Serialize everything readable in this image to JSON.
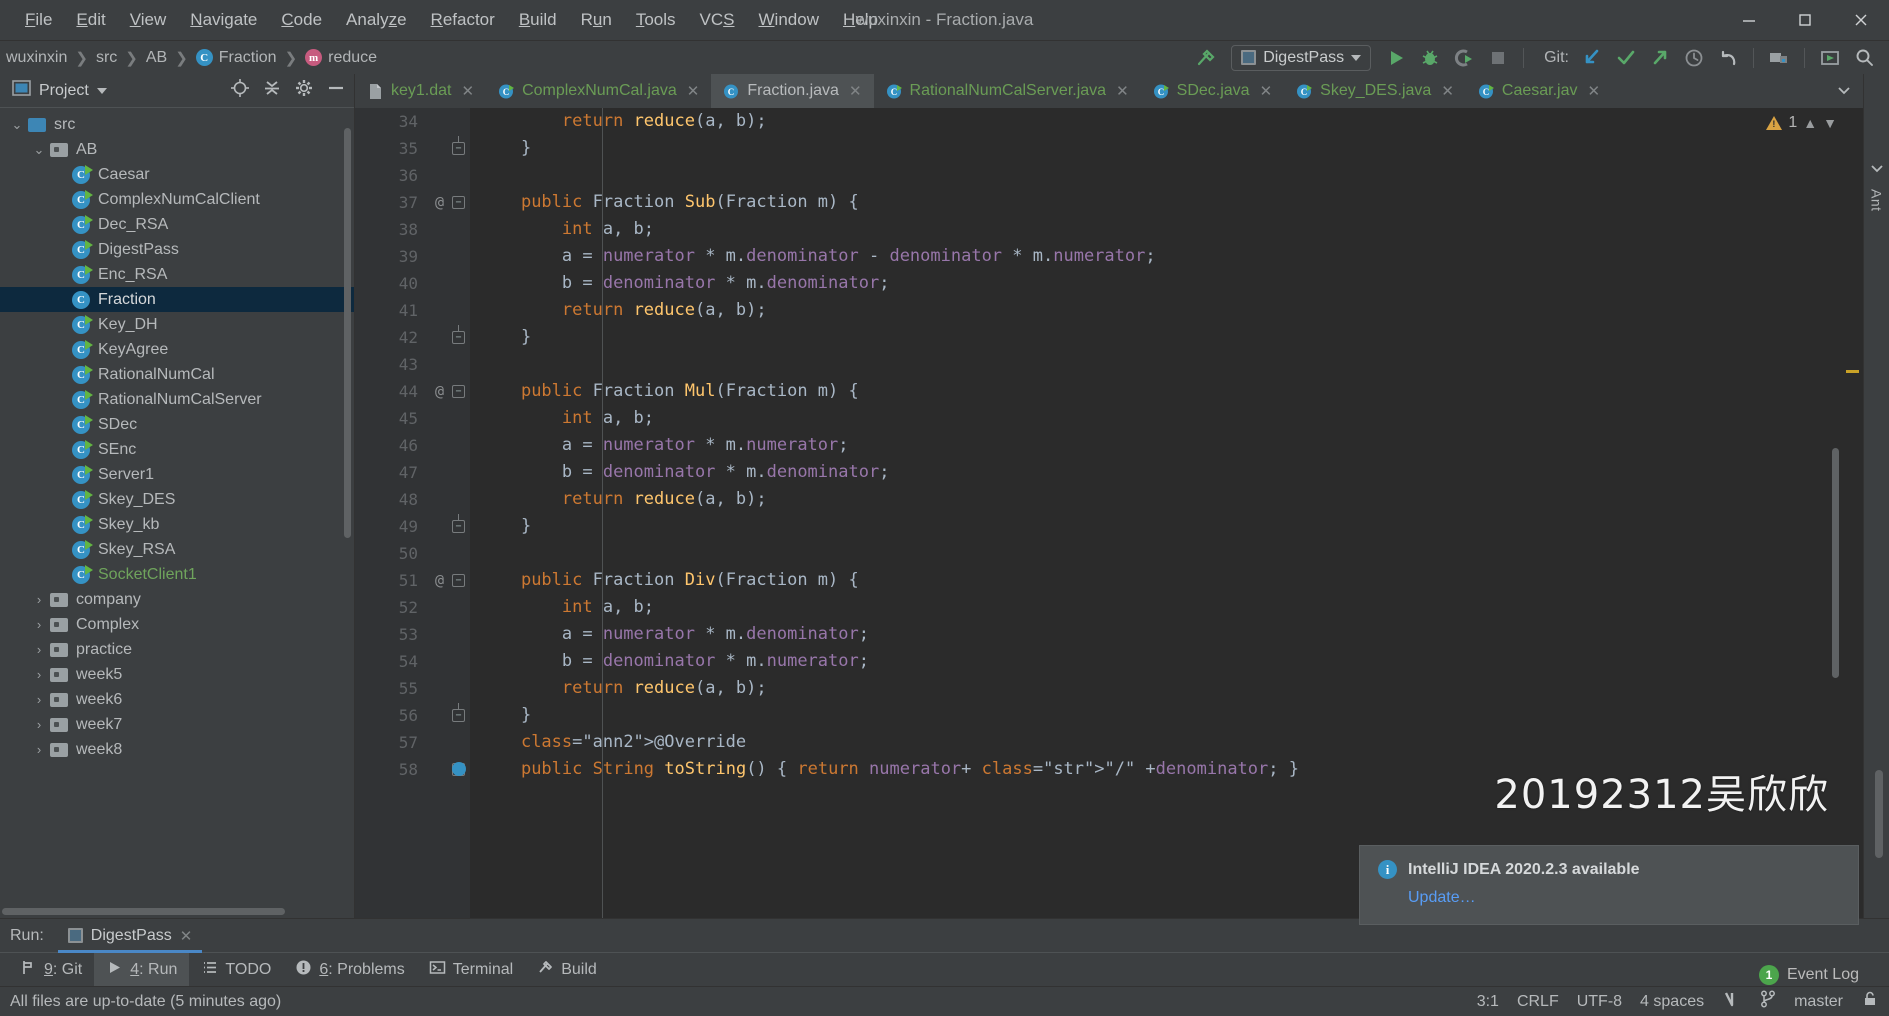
{
  "window": {
    "title": "wuxinxin - Fraction.java",
    "minimize": "minimize-icon",
    "maximize": "maximize-icon",
    "close": "close-icon"
  },
  "menu": [
    {
      "label": "File",
      "mnemonic": "F"
    },
    {
      "label": "Edit",
      "mnemonic": "E"
    },
    {
      "label": "View",
      "mnemonic": "V"
    },
    {
      "label": "Navigate",
      "mnemonic": "N"
    },
    {
      "label": "Code",
      "mnemonic": "C"
    },
    {
      "label": "Analyze",
      "mnemonic": "z"
    },
    {
      "label": "Refactor",
      "mnemonic": "R"
    },
    {
      "label": "Build",
      "mnemonic": "B"
    },
    {
      "label": "Run",
      "mnemonic": "u"
    },
    {
      "label": "Tools",
      "mnemonic": "T"
    },
    {
      "label": "VCS",
      "mnemonic": "S"
    },
    {
      "label": "Window",
      "mnemonic": "W"
    },
    {
      "label": "Help",
      "mnemonic": "H"
    }
  ],
  "breadcrumbs": [
    {
      "label": "wuxinxin",
      "icon": "none"
    },
    {
      "label": "src",
      "icon": "none"
    },
    {
      "label": "AB",
      "icon": "none"
    },
    {
      "label": "Fraction",
      "icon": "class"
    },
    {
      "label": "reduce",
      "icon": "method"
    }
  ],
  "toolbar": {
    "build_icon": "hammer-icon",
    "run_config": "DigestPass",
    "run_button": "run-icon",
    "debug_button": "debug-icon",
    "coverage_button": "run-with-coverage-icon",
    "stop_button": "stop-icon",
    "git_label": "Git:",
    "git_update": "update-project-icon",
    "git_commit": "commit-icon",
    "git_push": "push-icon",
    "git_history": "history-icon",
    "git_rollback": "rollback-icon",
    "project_structure": "project-structure-icon",
    "select_in": "select-in-icon",
    "search": "search-everywhere-icon"
  },
  "project_panel": {
    "title": "Project",
    "locate_icon": "locate-icon",
    "collapse_icon": "collapse-all-icon",
    "settings_icon": "gear-icon",
    "hide_icon": "hide-icon",
    "tree": [
      {
        "label": "src",
        "depth": 1,
        "type": "folder-src",
        "expanded": true,
        "selected": false
      },
      {
        "label": "AB",
        "depth": 2,
        "type": "folder",
        "expanded": true,
        "selected": false
      },
      {
        "label": "Caesar",
        "depth": 3,
        "type": "class-run",
        "selected": false
      },
      {
        "label": "ComplexNumCalClient",
        "depth": 3,
        "type": "class-run",
        "selected": false
      },
      {
        "label": "Dec_RSA",
        "depth": 3,
        "type": "class-run",
        "selected": false
      },
      {
        "label": "DigestPass",
        "depth": 3,
        "type": "class-run",
        "selected": false
      },
      {
        "label": "Enc_RSA",
        "depth": 3,
        "type": "class-run",
        "selected": false
      },
      {
        "label": "Fraction",
        "depth": 3,
        "type": "class",
        "selected": true
      },
      {
        "label": "Key_DH",
        "depth": 3,
        "type": "class-run",
        "selected": false
      },
      {
        "label": "KeyAgree",
        "depth": 3,
        "type": "class-run",
        "selected": false
      },
      {
        "label": "RationalNumCal",
        "depth": 3,
        "type": "class-run",
        "selected": false
      },
      {
        "label": "RationalNumCalServer",
        "depth": 3,
        "type": "class-run",
        "selected": false
      },
      {
        "label": "SDec",
        "depth": 3,
        "type": "class-run",
        "selected": false
      },
      {
        "label": "SEnc",
        "depth": 3,
        "type": "class-run",
        "selected": false
      },
      {
        "label": "Server1",
        "depth": 3,
        "type": "class-run",
        "selected": false
      },
      {
        "label": "Skey_DES",
        "depth": 3,
        "type": "class-run",
        "selected": false
      },
      {
        "label": "Skey_kb",
        "depth": 3,
        "type": "class-run",
        "selected": false
      },
      {
        "label": "Skey_RSA",
        "depth": 3,
        "type": "class-run",
        "selected": false
      },
      {
        "label": "SocketClient1",
        "depth": 3,
        "type": "class-run",
        "selected": false,
        "color": "green"
      },
      {
        "label": "company",
        "depth": 2,
        "type": "folder",
        "expanded": false,
        "selected": false
      },
      {
        "label": "Complex",
        "depth": 2,
        "type": "folder",
        "expanded": false,
        "selected": false
      },
      {
        "label": "practice",
        "depth": 2,
        "type": "folder",
        "expanded": false,
        "selected": false
      },
      {
        "label": "week5",
        "depth": 2,
        "type": "folder",
        "expanded": false,
        "selected": false
      },
      {
        "label": "week6",
        "depth": 2,
        "type": "folder",
        "expanded": false,
        "selected": false
      },
      {
        "label": "week7",
        "depth": 2,
        "type": "folder",
        "expanded": false,
        "selected": false
      },
      {
        "label": "week8",
        "depth": 2,
        "type": "folder",
        "expanded": false,
        "selected": false
      }
    ]
  },
  "editor_tabs": [
    {
      "label": "key1.dat",
      "icon": "file-icon",
      "active": false,
      "color": "green"
    },
    {
      "label": "ComplexNumCal.java",
      "icon": "class-run",
      "active": false,
      "color": "green"
    },
    {
      "label": "Fraction.java",
      "icon": "class",
      "active": true,
      "color": "normal"
    },
    {
      "label": "RationalNumCalServer.java",
      "icon": "class-run",
      "active": false,
      "color": "green"
    },
    {
      "label": "SDec.java",
      "icon": "class-run",
      "active": false,
      "color": "green"
    },
    {
      "label": "Skey_DES.java",
      "icon": "class-run",
      "active": false,
      "color": "green"
    },
    {
      "label": "Caesar.jav",
      "icon": "class-run",
      "active": false,
      "color": "green"
    }
  ],
  "editor": {
    "warning_count": "1",
    "first_line": 34,
    "lines": [
      {
        "n": 34,
        "ann": "",
        "fold": "",
        "text": "        return reduce(a, b);"
      },
      {
        "n": 35,
        "ann": "",
        "fold": "end",
        "text": "    }"
      },
      {
        "n": 36,
        "ann": "",
        "fold": "",
        "text": ""
      },
      {
        "n": 37,
        "ann": "@",
        "fold": "start",
        "text": "    public Fraction Sub(Fraction m) {"
      },
      {
        "n": 38,
        "ann": "",
        "fold": "",
        "text": "        int a, b;"
      },
      {
        "n": 39,
        "ann": "",
        "fold": "",
        "text": "        a = numerator * m.denominator - denominator * m.numerator;"
      },
      {
        "n": 40,
        "ann": "",
        "fold": "",
        "text": "        b = denominator * m.denominator;"
      },
      {
        "n": 41,
        "ann": "",
        "fold": "",
        "text": "        return reduce(a, b);"
      },
      {
        "n": 42,
        "ann": "",
        "fold": "end",
        "text": "    }"
      },
      {
        "n": 43,
        "ann": "",
        "fold": "",
        "text": ""
      },
      {
        "n": 44,
        "ann": "@",
        "fold": "start",
        "text": "    public Fraction Mul(Fraction m) {"
      },
      {
        "n": 45,
        "ann": "",
        "fold": "",
        "text": "        int a, b;"
      },
      {
        "n": 46,
        "ann": "",
        "fold": "",
        "text": "        a = numerator * m.numerator;"
      },
      {
        "n": 47,
        "ann": "",
        "fold": "",
        "text": "        b = denominator * m.denominator;"
      },
      {
        "n": 48,
        "ann": "",
        "fold": "",
        "text": "        return reduce(a, b);"
      },
      {
        "n": 49,
        "ann": "",
        "fold": "end",
        "text": "    }"
      },
      {
        "n": 50,
        "ann": "",
        "fold": "",
        "text": ""
      },
      {
        "n": 51,
        "ann": "@",
        "fold": "start",
        "text": "    public Fraction Div(Fraction m) {"
      },
      {
        "n": 52,
        "ann": "",
        "fold": "",
        "text": "        int a, b;"
      },
      {
        "n": 53,
        "ann": "",
        "fold": "",
        "text": "        a = numerator * m.denominator;"
      },
      {
        "n": 54,
        "ann": "",
        "fold": "",
        "text": "        b = denominator * m.numerator;"
      },
      {
        "n": 55,
        "ann": "",
        "fold": "",
        "text": "        return reduce(a, b);"
      },
      {
        "n": 56,
        "ann": "",
        "fold": "end",
        "text": "    }"
      },
      {
        "n": 57,
        "ann": "",
        "fold": "",
        "text": "    @Override"
      },
      {
        "n": 58,
        "ann": "",
        "fold": "start",
        "text": "    public String toString() { return numerator+ \"/\" +denominator; }"
      }
    ]
  },
  "right_strip": {
    "ant_label": "Ant"
  },
  "run_window": {
    "label": "Run:",
    "tab": "DigestPass",
    "close": "close-icon"
  },
  "tool_buttons": [
    {
      "label": "9: Git",
      "mnemonic": "9",
      "icon": "git-icon",
      "active": false
    },
    {
      "label": "4: Run",
      "mnemonic": "4",
      "icon": "run-icon",
      "active": true
    },
    {
      "label": "TODO",
      "mnemonic": "",
      "icon": "todo-icon",
      "active": false
    },
    {
      "label": "6: Problems",
      "mnemonic": "6",
      "icon": "problems-icon",
      "active": false
    },
    {
      "label": "Terminal",
      "mnemonic": "",
      "icon": "terminal-icon",
      "active": false
    },
    {
      "label": "Build",
      "mnemonic": "",
      "icon": "build-icon",
      "active": false
    }
  ],
  "status_bar": {
    "message": "All files are up-to-date (5 minutes ago)",
    "caret": "3:1",
    "line_sep": "CRLF",
    "encoding": "UTF-8",
    "indent": "4 spaces",
    "inspection_icon": "inspection-icon",
    "branch": "master",
    "branch_icon": "branch-icon",
    "lock_icon": "lock-icon"
  },
  "event_log": {
    "count": "1",
    "label": "Event Log"
  },
  "watermark": {
    "text": "20192312吴欣欣"
  },
  "notification": {
    "title": "IntelliJ IDEA 2020.2.3 available",
    "action": "Update…",
    "icon": "info-icon"
  }
}
